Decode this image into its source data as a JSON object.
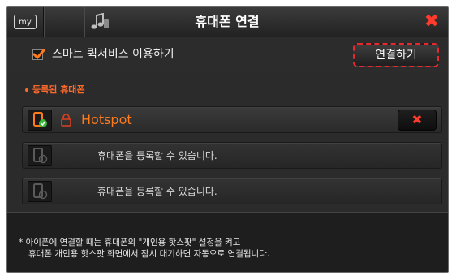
{
  "titlebar": {
    "my_badge": "my",
    "title": "휴대폰 연결",
    "close_symbol": "✖",
    "music_icon": "music-note-icon",
    "accent_color": "#ff3b2c"
  },
  "quick_service": {
    "checked": true,
    "label": "스마트 퀵서비스 이용하기",
    "connect_label": "연결하기"
  },
  "registered": {
    "section_label": "등록된 휴대폰",
    "devices": [
      {
        "name": "Hotspot",
        "connected": true,
        "delete_symbol": "✖"
      }
    ],
    "empty_slots": [
      {
        "text": "휴대폰을 등록할 수 있습니다."
      },
      {
        "text": "휴대폰을 등록할 수 있습니다."
      }
    ]
  },
  "footer": {
    "line1": "* 아이폰에 연결할 때는 휴대폰의 \"개인용 핫스팟\" 설정을 켜고",
    "line2": "휴대폰 개인용 핫스팟 화면에서 잠시 대기하면 자동으로 연결됩니다."
  },
  "colors": {
    "orange": "#ff7a1a",
    "red": "#ff3b2c",
    "green": "#3cb83c"
  }
}
